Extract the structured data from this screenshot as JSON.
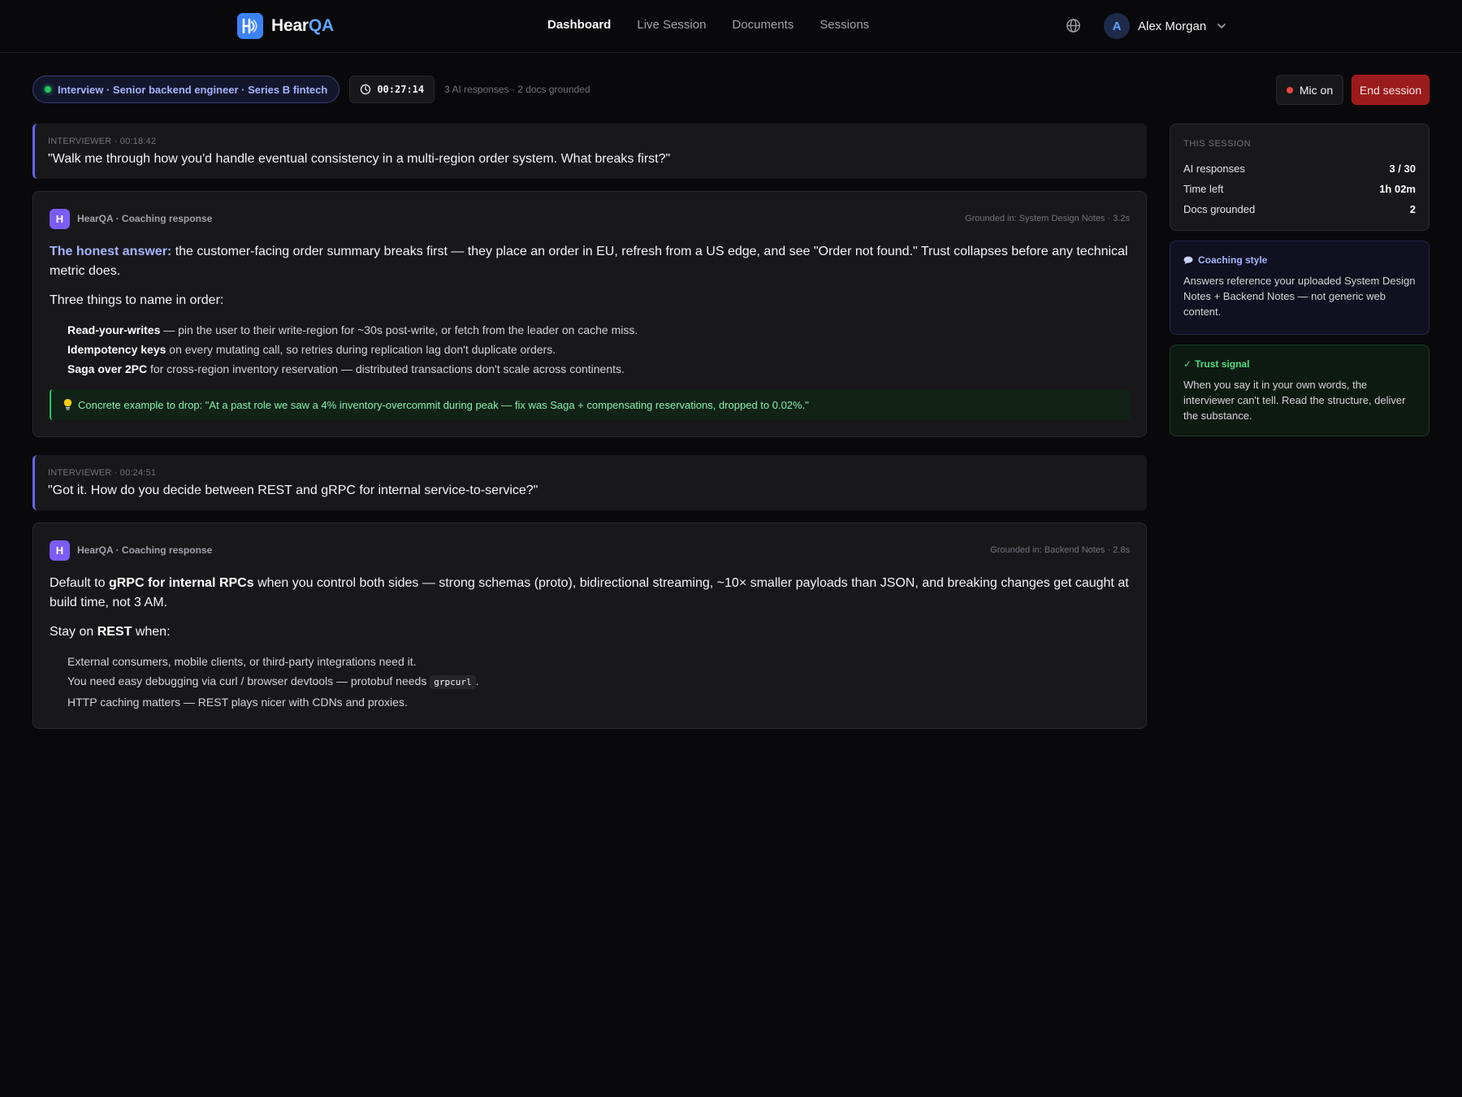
{
  "app": {
    "brand_part1": "Hear",
    "brand_part2": "QA"
  },
  "nav": {
    "items": [
      {
        "label": "Dashboard",
        "active": true
      },
      {
        "label": "Live Session",
        "active": false
      },
      {
        "label": "Documents",
        "active": false
      },
      {
        "label": "Sessions",
        "active": false
      }
    ],
    "language_icon": "globe-icon"
  },
  "user": {
    "initial": "A",
    "name": "Alex Morgan"
  },
  "status": {
    "session_label": "Interview · Senior backend engineer · Series B fintech",
    "timer": "00:27:14",
    "meta": "3 AI responses · 2 docs grounded",
    "mic_label": "Mic on",
    "end_label": "End session"
  },
  "feed": {
    "q1": {
      "meta": "INTERVIEWER · 00:18:42",
      "text": "\"Walk me through how you'd handle eventual consistency in a multi-region order system. What breaks first?\""
    },
    "a1": {
      "badge": "H",
      "label": "HearQA · Coaching response",
      "grounded": "Grounded in: System Design Notes · 3.2s",
      "lead": "The honest answer:",
      "p1_rest": " the customer-facing order summary breaks first — they place an order in EU, refresh from a US edge, and see \"Order not found.\" Trust collapses before any technical metric does.",
      "p2": "Three things to name in order:",
      "items": [
        {
          "strong": "Read-your-writes",
          "rest": " — pin the user to their write-region for ~30s post-write, or fetch from the leader on cache miss."
        },
        {
          "strong": "Idempotency keys",
          "rest": " on every mutating call, so retries during replication lag don't duplicate orders."
        },
        {
          "strong": "Saga over 2PC",
          "rest": " for cross-region inventory reservation — distributed transactions don't scale across continents."
        }
      ],
      "tip": "Concrete example to drop: \"At a past role we saw a 4% inventory-overcommit during peak — fix was Saga + compensating reservations, dropped to 0.02%.\""
    },
    "q2": {
      "meta": "INTERVIEWER · 00:24:51",
      "text": "\"Got it. How do you decide between REST and gRPC for internal service-to-service?\""
    },
    "a2": {
      "badge": "H",
      "label": "HearQA · Coaching response",
      "grounded": "Grounded in: Backend Notes · 2.8s",
      "p1_pre": "Default to ",
      "p1_strong": "gRPC for internal RPCs",
      "p1_rest": " when you control both sides — strong schemas (proto), bidirectional streaming, ~10× smaller payloads than JSON, and breaking changes get caught at build time, not 3 AM.",
      "p2_pre": "Stay on ",
      "p2_strong": "REST",
      "p2_rest": " when:",
      "item1": "External consumers, mobile clients, or third-party integrations need it.",
      "item2_pre": "You need easy debugging via curl / browser devtools — protobuf needs ",
      "item2_code": "grpcurl",
      "item2_post": ".",
      "item3": "HTTP caching matters — REST plays nicer with CDNs and proxies."
    }
  },
  "sidebar": {
    "stats_title": "THIS SESSION",
    "stats": [
      {
        "label": "AI responses",
        "value": "3 / 30"
      },
      {
        "label": "Time left",
        "value": "1h 02m"
      },
      {
        "label": "Docs grounded",
        "value": "2"
      }
    ],
    "coaching_title": "Coaching style",
    "coaching_body": "Answers reference your uploaded System Design Notes + Backend Notes — not generic web content.",
    "trust_title": "Trust signal",
    "trust_body": "When you say it in your own words, the interviewer can't tell. Read the structure, deliver the substance."
  },
  "colors": {
    "accent": "#6366f1",
    "brand": "#3b82f6",
    "danger": "#991b1b",
    "success": "#22c55e"
  }
}
